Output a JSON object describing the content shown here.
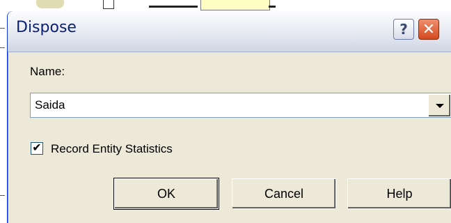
{
  "dialog": {
    "title": "Dispose",
    "help_glyph": "?",
    "close_glyph": "✕",
    "name_label": "Name:",
    "name_value": "Saida",
    "record_stats_label": "Record Entity Statistics",
    "record_stats_checked": true,
    "check_glyph": "✔",
    "buttons": {
      "ok": "OK",
      "cancel": "Cancel",
      "help": "Help"
    }
  },
  "icons": {
    "help": "question-mark-icon",
    "close": "close-icon",
    "dropdown": "chevron-down-icon",
    "check": "checkmark-icon"
  },
  "colors": {
    "dialog_bg": "#ece9d8",
    "title_text": "#0a1f6e",
    "close_red": "#d54a1e",
    "field_border": "#7f9db9"
  }
}
